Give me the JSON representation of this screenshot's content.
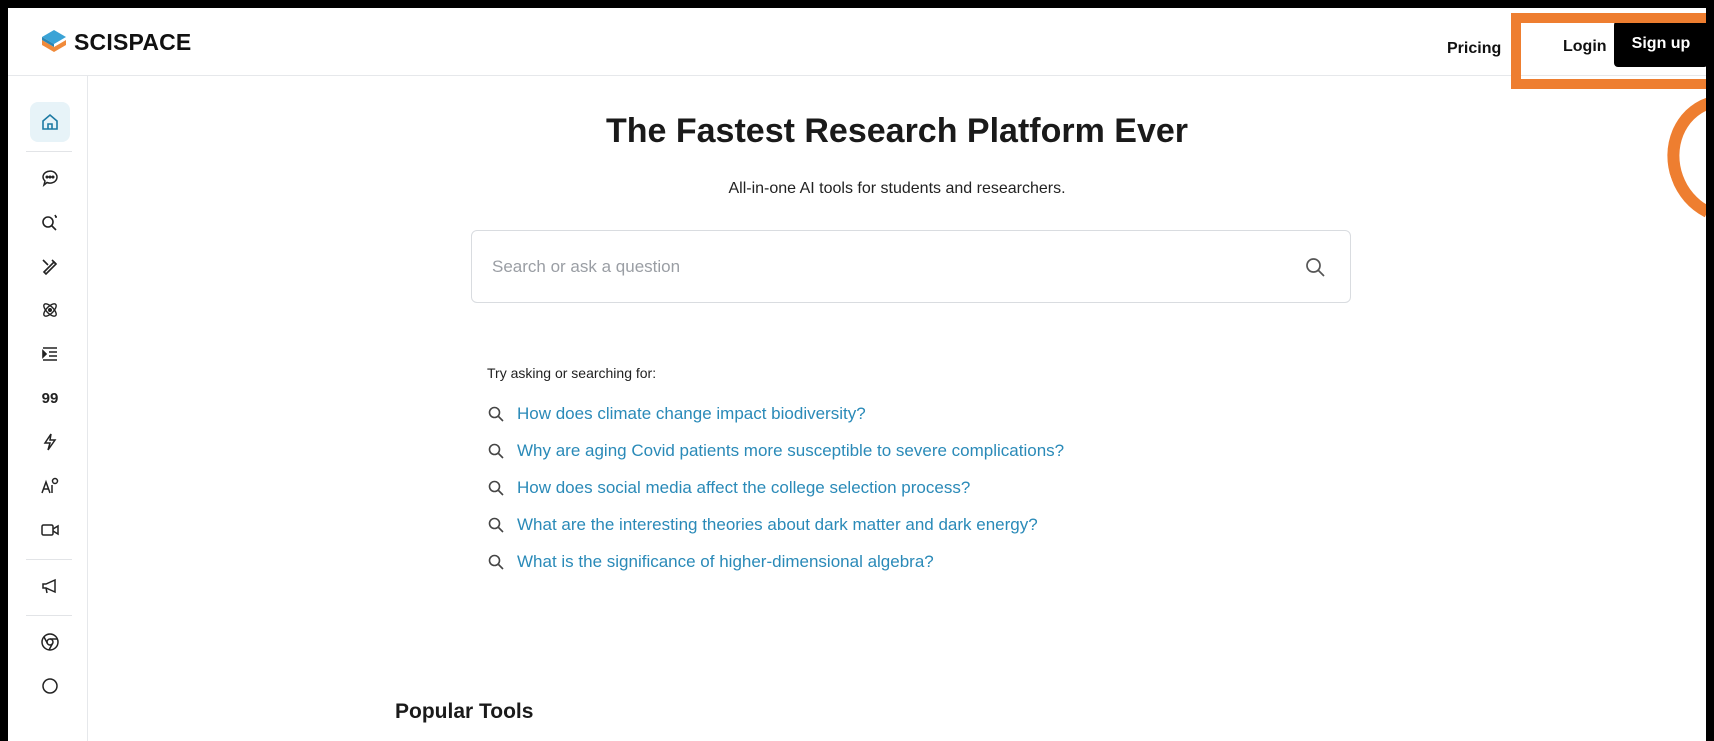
{
  "header": {
    "brand": "SCISPACE",
    "nav_pricing": "Pricing",
    "login": "Login",
    "signup": "Sign up"
  },
  "sidebar": {
    "items": [
      {
        "icon": "home-icon",
        "active": true
      },
      {
        "icon": "chat-icon"
      },
      {
        "icon": "literature-search-icon"
      },
      {
        "icon": "pen-writer-icon"
      },
      {
        "icon": "atom-icon"
      },
      {
        "icon": "outline-list-icon"
      },
      {
        "icon": "citation-icon",
        "glyph": "99"
      },
      {
        "icon": "lightning-icon"
      },
      {
        "icon": "ai-detector-icon"
      },
      {
        "icon": "video-icon"
      },
      {
        "icon": "megaphone-icon"
      },
      {
        "icon": "chrome-extension-icon"
      }
    ]
  },
  "main": {
    "headline": "The Fastest Research Platform Ever",
    "subheadline": "All-in-one AI tools for students and researchers.",
    "search": {
      "placeholder": "Search or ask a question"
    },
    "try_label": "Try asking or searching for:",
    "suggestions": [
      "How does climate change impact biodiversity?",
      "Why are aging Covid patients more susceptible to severe complications?",
      "How does social media affect the college selection process?",
      "What are the interesting theories about dark matter and dark energy?",
      "What is the significance of higher-dimensional algebra?"
    ],
    "popular_tools_heading": "Popular Tools"
  },
  "colors": {
    "accent_link": "#2a8ab8",
    "annotation": "#ee7e30",
    "signup_bg": "#000000"
  }
}
